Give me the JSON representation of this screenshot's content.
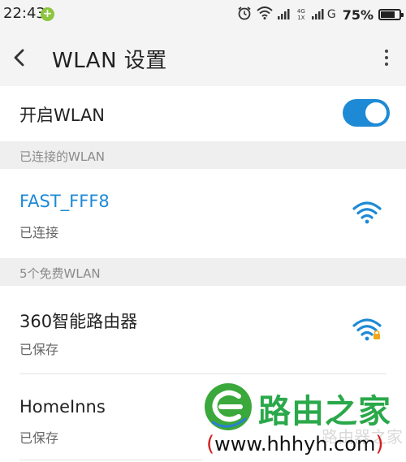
{
  "status_bar": {
    "time": "22:43",
    "badge_symbol": "+",
    "network_top": "4G",
    "network_bottom": "1X",
    "sim2_network": "G",
    "battery_percent": "75%",
    "battery_level": 0.75,
    "icons": [
      "alarm-icon",
      "wifi-signal-icon",
      "cell-signal-icon",
      "cell-signal-icon",
      "battery-icon"
    ]
  },
  "toolbar": {
    "title": "WLAN 设置",
    "back_icon": "chevron-left-icon",
    "more_icon": "more-vertical-icon"
  },
  "wlan_toggle": {
    "label": "开启WLAN",
    "enabled": true,
    "accent_color": "#1e8ad6"
  },
  "connected_section": {
    "header": "已连接的WLAN",
    "network": {
      "name": "FAST_FFF8",
      "status": "已连接",
      "locked": false
    }
  },
  "free_section": {
    "header": "5个免费WLAN",
    "networks": [
      {
        "name": "360智能路由器",
        "status": "已保存",
        "locked": true
      },
      {
        "name": "HomeInns",
        "status": "已保存",
        "locked": false
      }
    ]
  },
  "watermark": {
    "title": "路由之家",
    "url": "www.hhhyh.com",
    "paren_open": "(",
    "paren_close": ")",
    "faint_text": "路由器之家"
  }
}
